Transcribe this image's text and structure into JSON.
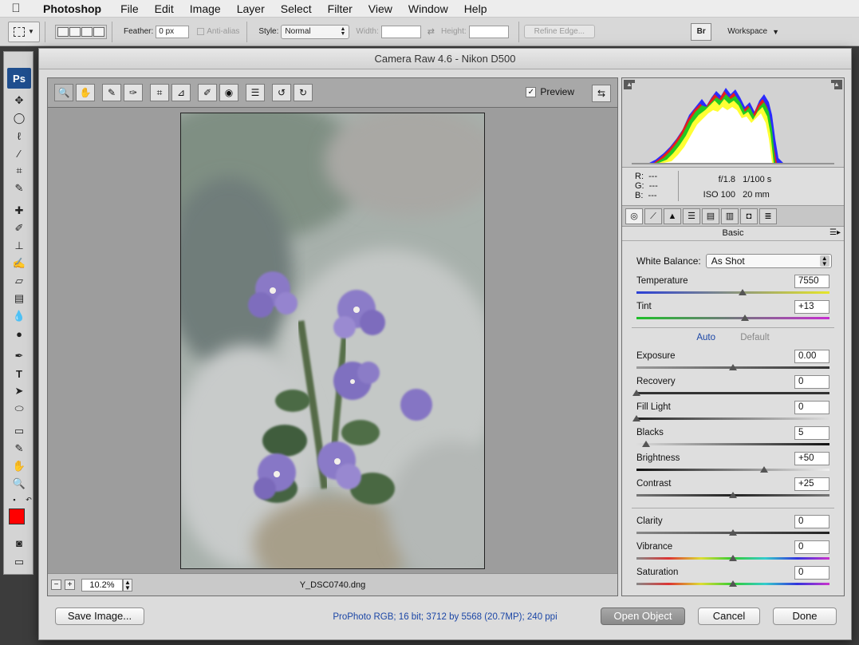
{
  "menubar": {
    "app_name": "Photoshop",
    "items": [
      "File",
      "Edit",
      "Image",
      "Layer",
      "Select",
      "Filter",
      "View",
      "Window",
      "Help"
    ]
  },
  "options_bar": {
    "feather_label": "Feather:",
    "feather_value": "0 px",
    "anti_alias_label": "Anti-alias",
    "style_label": "Style:",
    "style_value": "Normal",
    "width_label": "Width:",
    "height_label": "Height:",
    "refine_edge_label": "Refine Edge...",
    "workspace_label": "Workspace"
  },
  "toolbox": {
    "badge": "Ps",
    "foreground_color": "#ff0000",
    "background_color": "#ffffff"
  },
  "dialog": {
    "title": "Camera Raw 4.6  -  Nikon D500",
    "preview_label": "Preview",
    "preview_checked": true,
    "zoom_value": "10.2%",
    "filename": "Y_DSC0740.dng",
    "workflow_info": "ProPhoto RGB; 16 bit; 3712 by 5568 (20.7MP); 240 ppi",
    "buttons": {
      "save_image": "Save Image...",
      "open_object": "Open Object",
      "cancel": "Cancel",
      "done": "Done"
    }
  },
  "info": {
    "r_label": "R:",
    "r_value": "---",
    "g_label": "G:",
    "g_value": "---",
    "b_label": "B:",
    "b_value": "---",
    "aperture": "f/1.8",
    "shutter": "1/100 s",
    "iso": "ISO 100",
    "focal_length": "20 mm"
  },
  "basic_panel": {
    "title": "Basic",
    "white_balance_label": "White Balance:",
    "white_balance_value": "As Shot",
    "auto_label": "Auto",
    "default_label": "Default",
    "sliders": [
      {
        "label": "Temperature",
        "value": "7550",
        "position": 0.55
      },
      {
        "label": "Tint",
        "value": "+13",
        "position": 0.56
      },
      {
        "label": "Exposure",
        "value": "0.00",
        "position": 0.5
      },
      {
        "label": "Recovery",
        "value": "0",
        "position": 0.0
      },
      {
        "label": "Fill Light",
        "value": "0",
        "position": 0.0
      },
      {
        "label": "Blacks",
        "value": "5",
        "position": 0.05
      },
      {
        "label": "Brightness",
        "value": "+50",
        "position": 0.66
      },
      {
        "label": "Contrast",
        "value": "+25",
        "position": 0.5
      },
      {
        "label": "Clarity",
        "value": "0",
        "position": 0.5
      },
      {
        "label": "Vibrance",
        "value": "0",
        "position": 0.5
      },
      {
        "label": "Saturation",
        "value": "0",
        "position": 0.5
      }
    ]
  },
  "colors": {
    "accent_link": "#1b46a6",
    "ps_badge": "#1f4e8e"
  }
}
